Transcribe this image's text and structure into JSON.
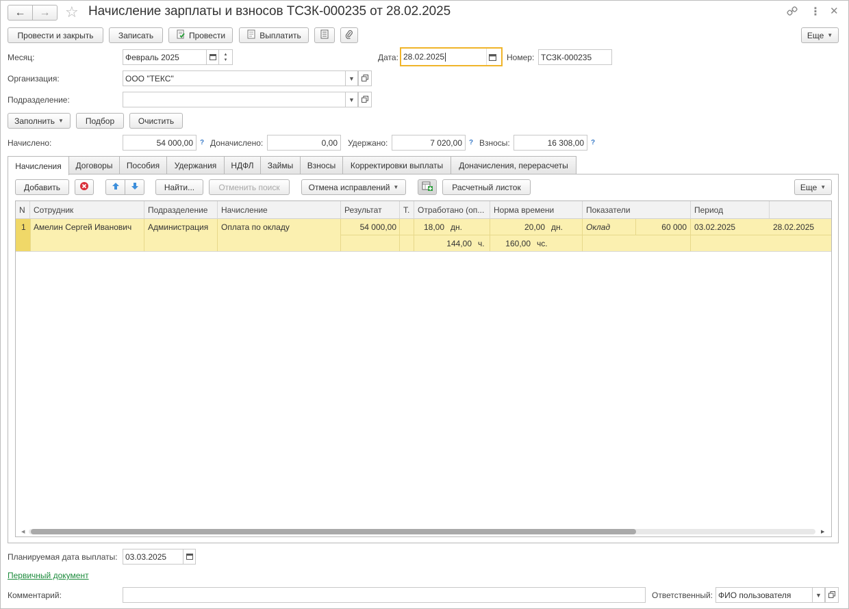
{
  "title": "Начисление зарплаты и взносов ТСЗК-000235 от 28.02.2025",
  "toolbar": {
    "post_close": "Провести и закрыть",
    "save": "Записать",
    "post": "Провести",
    "pay": "Выплатить",
    "more": "Еще"
  },
  "header": {
    "month_label": "Месяц:",
    "month_value": "Февраль 2025",
    "date_label": "Дата:",
    "date_value": "28.02.2025",
    "number_label": "Номер:",
    "number_value": "ТСЗК-000235",
    "org_label": "Организация:",
    "org_value": "ООО \"ТЕКС\"",
    "dept_label": "Подразделение:",
    "dept_value": ""
  },
  "actions": {
    "fill": "Заполнить",
    "select": "Подбор",
    "clear": "Очистить"
  },
  "totals": {
    "accrued_label": "Начислено:",
    "accrued_value": "54 000,00",
    "additional_label": "Доначислено:",
    "additional_value": "0,00",
    "withheld_label": "Удержано:",
    "withheld_value": "7 020,00",
    "contrib_label": "Взносы:",
    "contrib_value": "16 308,00",
    "help": "?"
  },
  "tabs": [
    "Начисления",
    "Договоры",
    "Пособия",
    "Удержания",
    "НДФЛ",
    "Займы",
    "Взносы",
    "Корректировки выплаты",
    "Доначисления, перерасчеты"
  ],
  "grid_toolbar": {
    "add": "Добавить",
    "find": "Найти...",
    "cancel_search": "Отменить поиск",
    "cancel_corrections": "Отмена исправлений",
    "payslip": "Расчетный листок",
    "more": "Еще"
  },
  "columns": [
    "N",
    "Сотрудник",
    "Подразделение",
    "Начисление",
    "Результат",
    "Т.",
    "Отработано (оп...",
    "Норма времени",
    "Показатели",
    "Период"
  ],
  "rows": [
    {
      "n": "1",
      "employee": "Амелин Сергей Иванович",
      "department": "Администрация",
      "accrual": "Оплата по окладу",
      "result": "54 000,00",
      "worked_days": "18,00",
      "worked_days_unit": "дн.",
      "worked_hours": "144,00",
      "worked_hours_unit": "ч.",
      "norm_days": "20,00",
      "norm_days_unit": "дн.",
      "norm_hours": "160,00",
      "norm_hours_unit": "чс.",
      "indicator_name": "Оклад",
      "indicator_value": "60 000",
      "period_start": "03.02.2025",
      "period_end": "28.02.2025"
    }
  ],
  "footer": {
    "pay_date_label": "Планируемая дата выплаты:",
    "pay_date_value": "03.03.2025",
    "primary_doc_link": "Первичный документ",
    "comment_label": "Комментарий:",
    "comment_value": "",
    "responsible_label": "Ответственный:",
    "responsible_value": "ФИО пользователя"
  },
  "colors": {
    "row_highlight": "#fbf0b0",
    "focus_border": "#f0b429",
    "link": "#1a8a3a",
    "help": "#3a7bc8"
  }
}
